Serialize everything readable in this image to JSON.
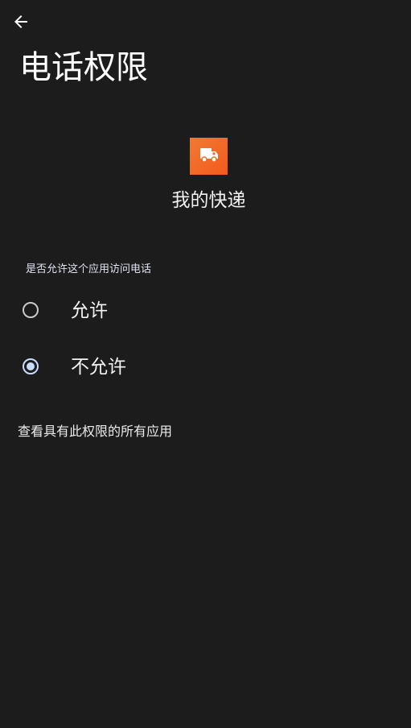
{
  "header": {
    "back_icon": "arrow-back-icon",
    "title": "电话权限"
  },
  "app": {
    "icon": "delivery-truck-icon",
    "icon_color": "#f26a28",
    "name": "我的快递"
  },
  "permission": {
    "question": "是否允许这个应用访问电话",
    "options": [
      {
        "label": "允许",
        "selected": false
      },
      {
        "label": "不允许",
        "selected": true
      }
    ],
    "accent_color": "#c9dcff"
  },
  "footer": {
    "all_apps_link": "查看具有此权限的所有应用"
  }
}
